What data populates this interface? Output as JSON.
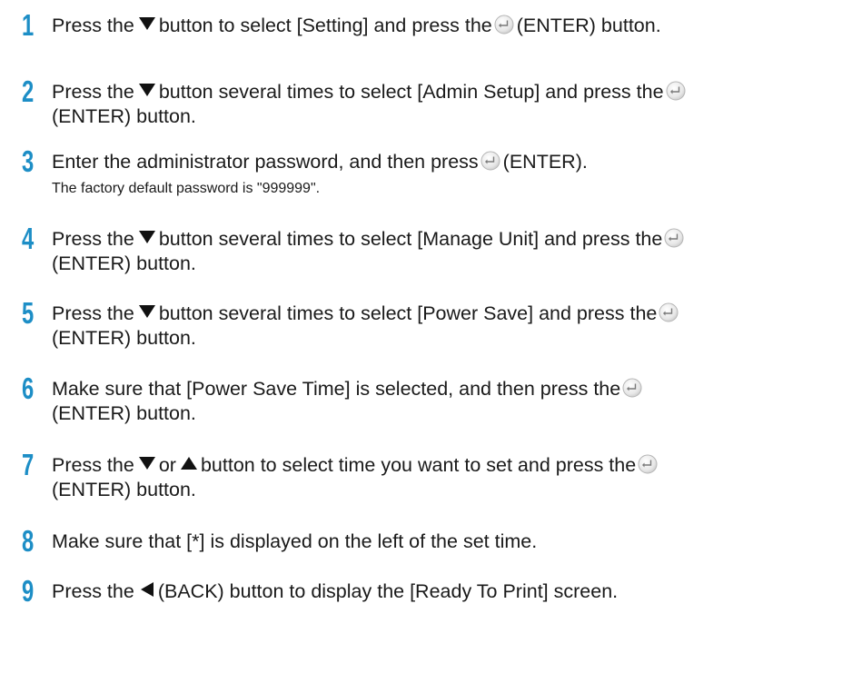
{
  "steps": [
    {
      "number": "1",
      "l1_a": "Press the",
      "l1_b": "button to select [Setting] and press the",
      "l1_c": "(ENTER) button."
    },
    {
      "number": "2",
      "l1_a": "Press the",
      "l1_b": "button several times to select [Admin Setup] and press the",
      "l2": "(ENTER) button."
    },
    {
      "number": "3",
      "l1_a": "Enter the administrator password, and then press",
      "l1_c": "(ENTER).",
      "note": "The factory default password is \"999999\"."
    },
    {
      "number": "4",
      "l1_a": "Press the",
      "l1_b": "button several times to select [Manage Unit] and press the",
      "l2": "(ENTER) button."
    },
    {
      "number": "5",
      "l1_a": "Press the",
      "l1_b": "button several times to select [Power Save] and press the",
      "l2": "(ENTER) button."
    },
    {
      "number": "6",
      "l1_a": "Make sure that [Power Save Time] is selected, and then press the",
      "l2": "(ENTER) button."
    },
    {
      "number": "7",
      "l1_a": "Press the",
      "l1_or": "or",
      "l1_b": "button to select time you want to set and press the",
      "l2": "(ENTER) button."
    },
    {
      "number": "8",
      "l1_a": "Make sure that [*] is displayed on the left of the set time."
    },
    {
      "number": "9",
      "l1_a": "Press the",
      "l1_b": "(BACK) button to display the [Ready To Print] screen."
    }
  ],
  "icons": {
    "down": "down-triangle-icon",
    "up": "up-triangle-icon",
    "back": "left-triangle-icon",
    "enter": "enter-button-icon"
  },
  "colors": {
    "step_number": "#1d8ec6",
    "text": "#1a1a1a"
  }
}
